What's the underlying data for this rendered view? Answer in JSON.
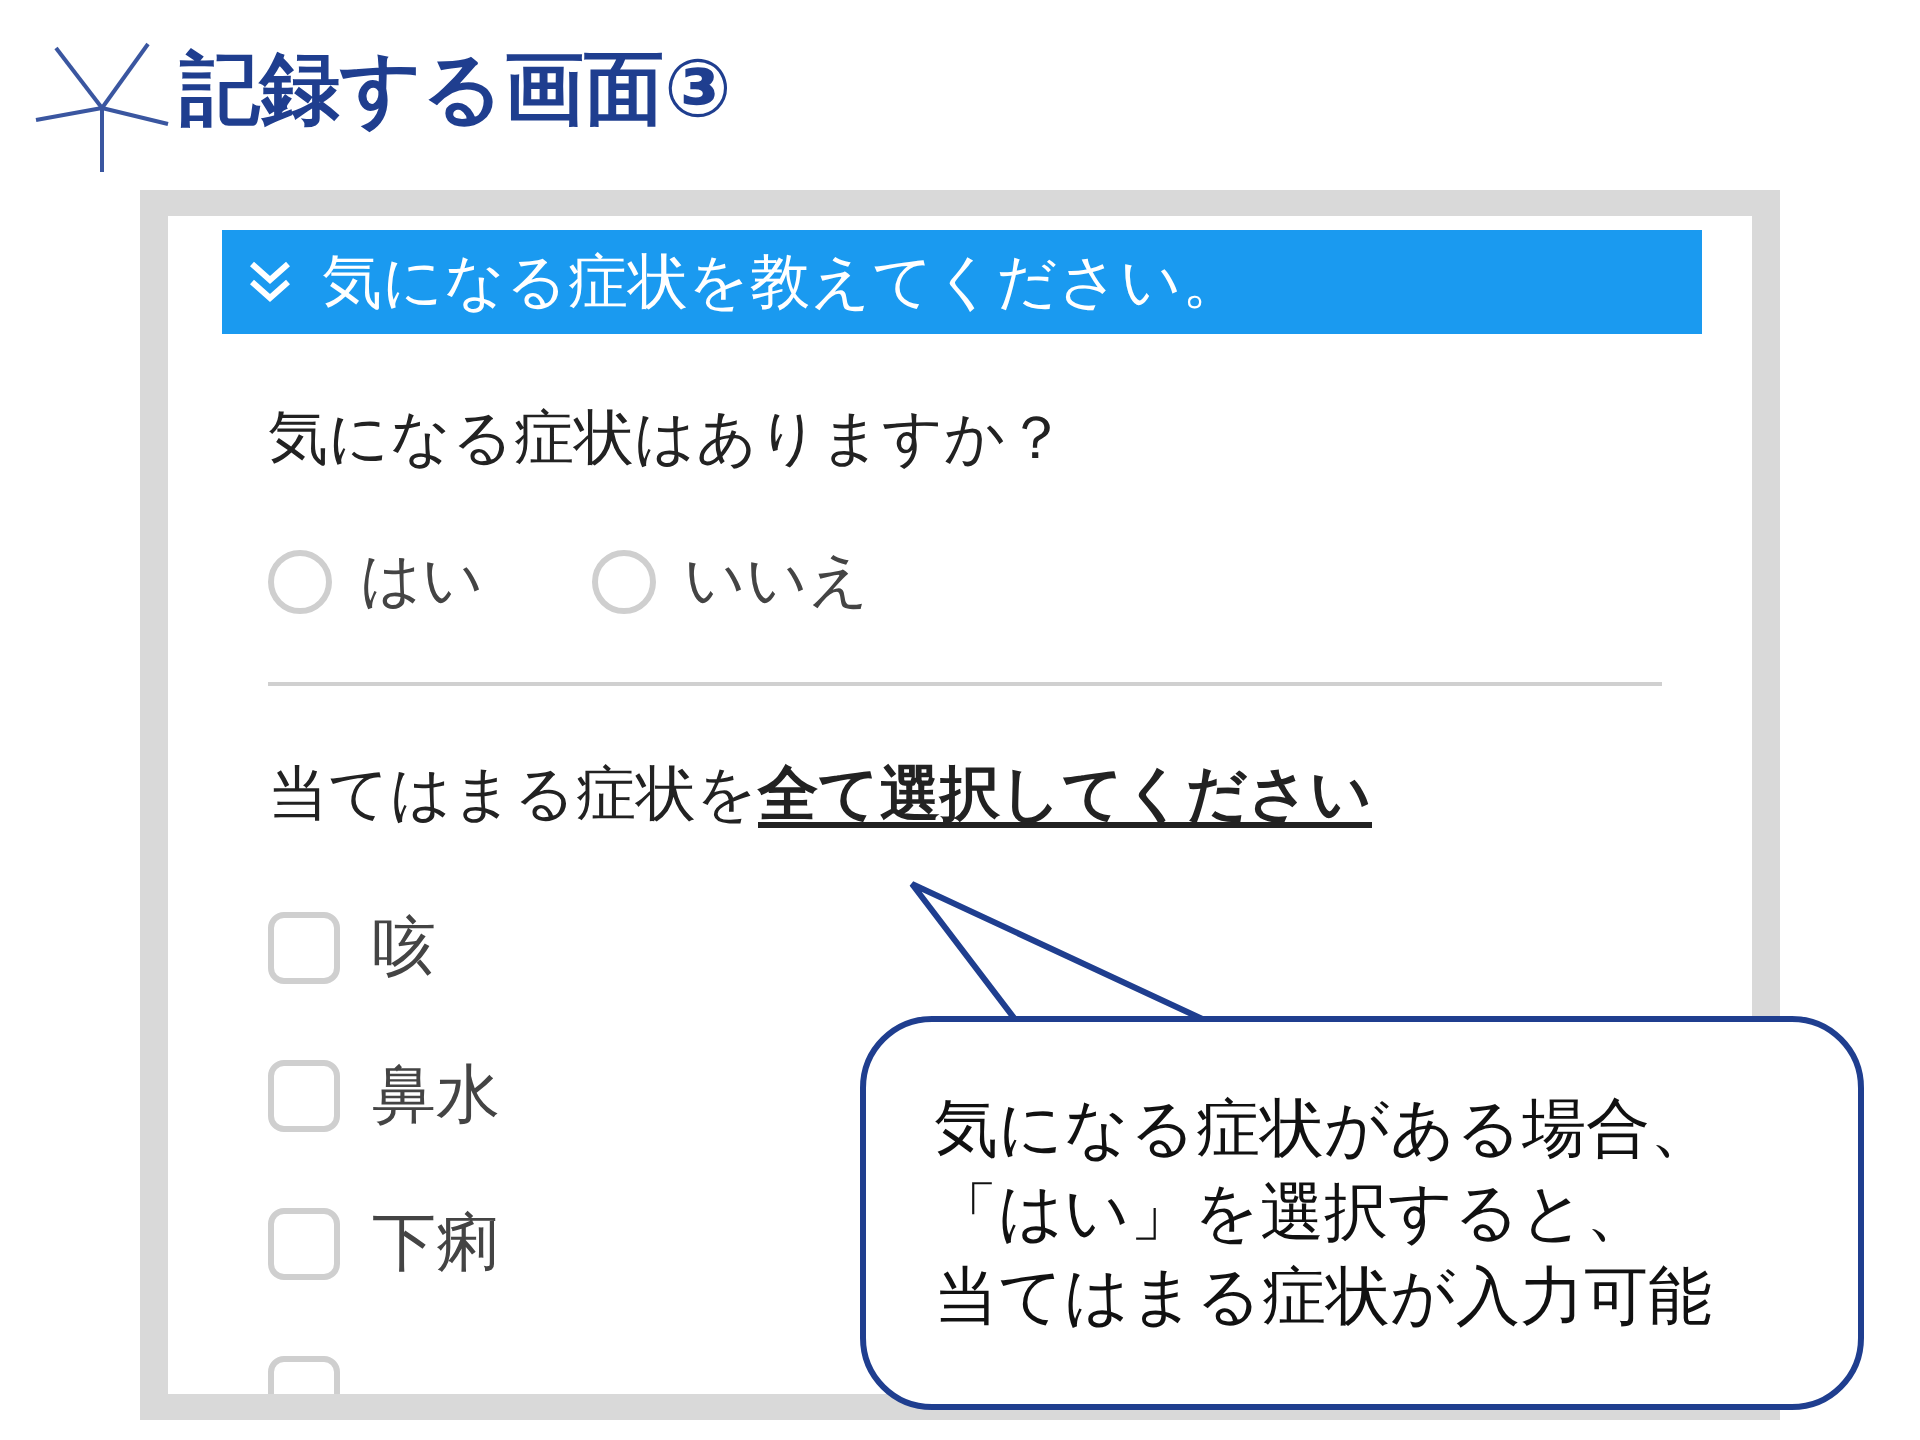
{
  "slide_title": "記録する画面③",
  "form": {
    "section_header": "気になる症状を教えてください。",
    "question_1": "気になる症状はありますか？",
    "options": [
      {
        "label": "はい",
        "selected": false
      },
      {
        "label": "いいえ",
        "selected": false
      }
    ],
    "question_2": "当てはまる症状を**全て選択してください**",
    "symptoms": [
      {
        "label": "咳",
        "checked": false
      },
      {
        "label": "鼻水",
        "checked": false
      },
      {
        "label": "下痢",
        "checked": false
      },
      {
        "checked": false
      }
    ]
  },
  "callout": {
    "lines": [
      "気になる症状がある場合、",
      "「はい」を選択すると、",
      "当てはまる症状が入力可能"
    ]
  }
}
